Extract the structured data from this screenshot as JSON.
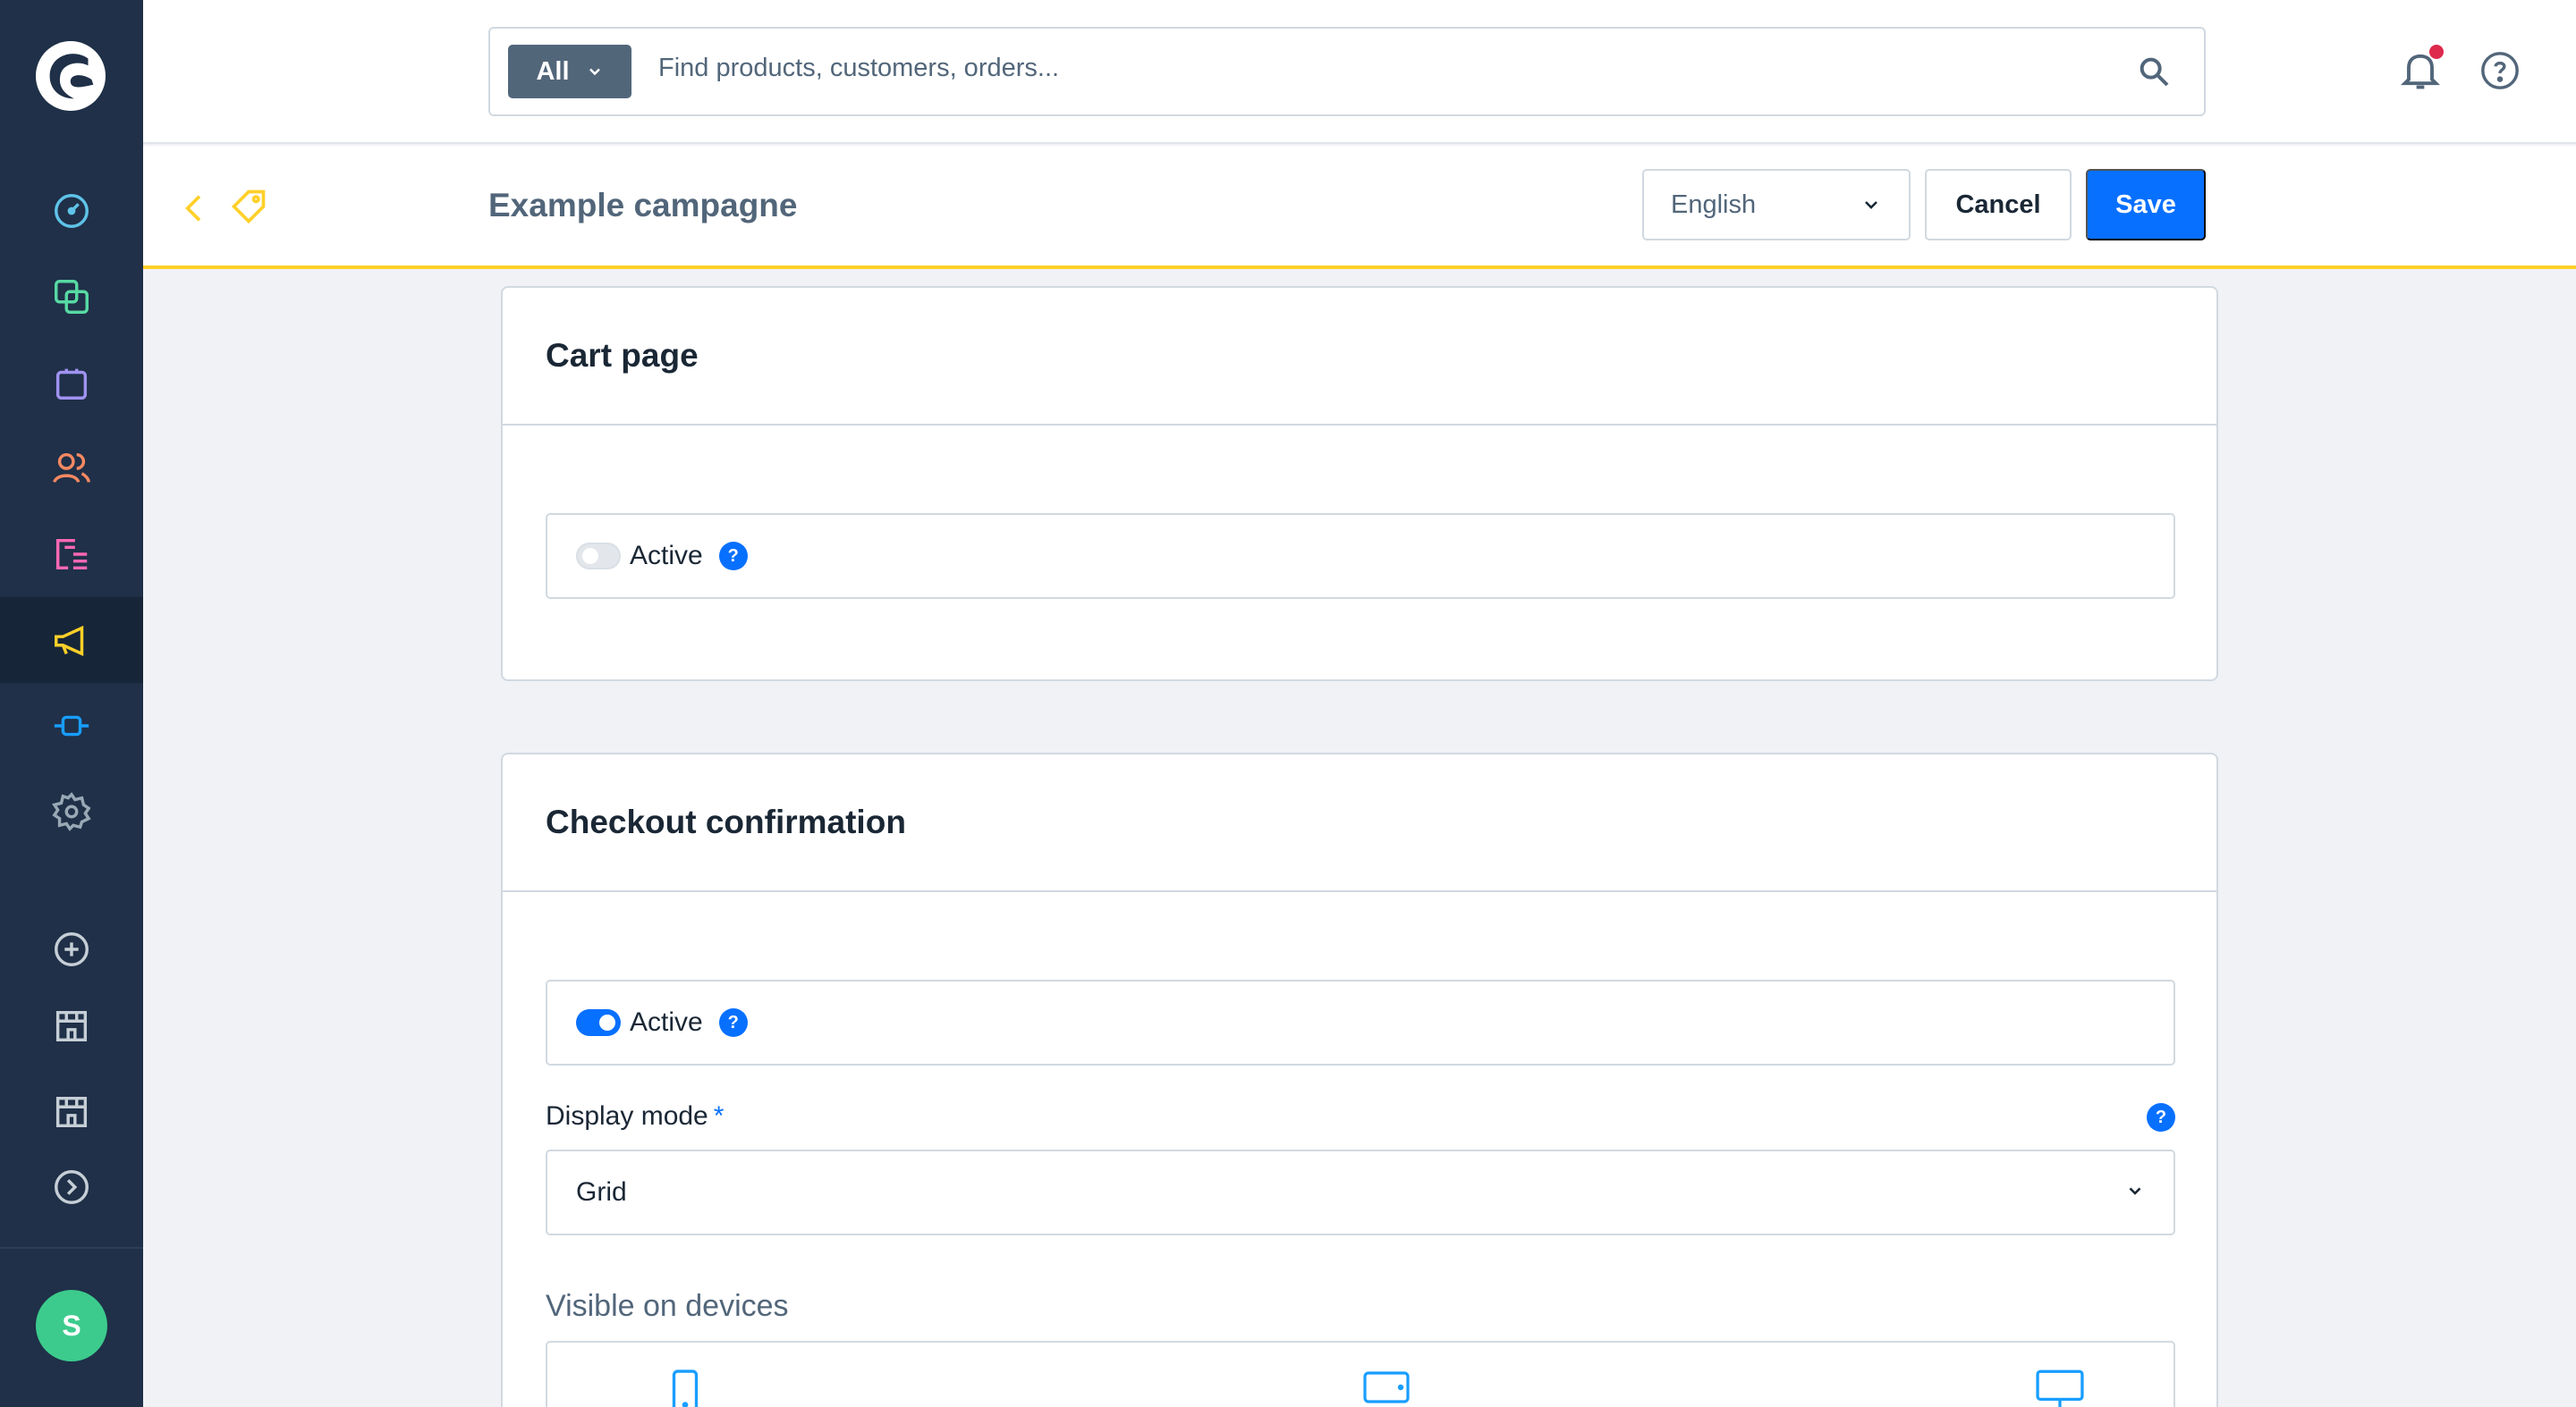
{
  "search": {
    "type_label": "All",
    "placeholder": "Find products, customers, orders..."
  },
  "smartbar": {
    "title": "Example campagne",
    "language": "English",
    "cancel_label": "Cancel",
    "save_label": "Save"
  },
  "user": {
    "initial": "S"
  },
  "cart_page": {
    "title": "Cart page",
    "active_label": "Active",
    "active": false,
    "help": "?"
  },
  "checkout_confirmation": {
    "title": "Checkout confirmation",
    "active_label": "Active",
    "active": true,
    "help": "?",
    "display_mode_label": "Display mode",
    "required_mark": "*",
    "display_mode_value": "Grid",
    "visible_devices_label": "Visible on devices"
  },
  "colors": {
    "sidebar": "#1f3048",
    "accent": "#0870ff",
    "highlight": "#ffd029",
    "avatar": "#3ccb8d"
  },
  "icons": {
    "sidebar": [
      "dashboard-icon",
      "catalog-icon",
      "orders-icon",
      "customers-icon",
      "content-icon",
      "marketing-icon",
      "extensions-icon",
      "settings-icon",
      "add-sales-channel-icon",
      "storefront-icon",
      "storefront-icon",
      "expand-icon"
    ]
  }
}
